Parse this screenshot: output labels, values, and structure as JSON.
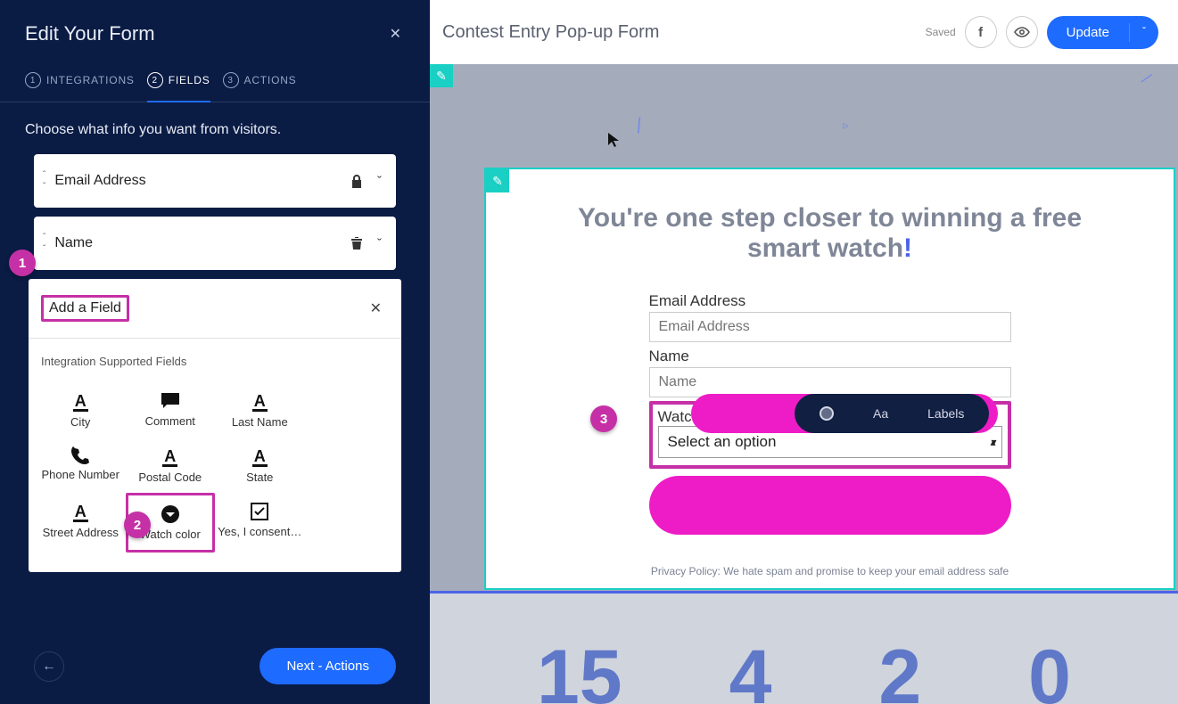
{
  "sidebar": {
    "title": "Edit Your Form",
    "steps": [
      {
        "num": "1",
        "label": "INTEGRATIONS"
      },
      {
        "num": "2",
        "label": "FIELDS"
      },
      {
        "num": "3",
        "label": "ACTIONS"
      }
    ],
    "subtitle": "Choose what info you want from visitors.",
    "fields": [
      {
        "label": "Email Address",
        "locked": true
      },
      {
        "label": "Name",
        "locked": false
      }
    ],
    "addField": {
      "title": "Add a Field",
      "sectionLabel": "Integration Supported Fields",
      "options": [
        {
          "label": "City",
          "icon": "text"
        },
        {
          "label": "Comment",
          "icon": "comment"
        },
        {
          "label": "Last Name",
          "icon": "text"
        },
        {
          "label": "Phone Number",
          "icon": "phone"
        },
        {
          "label": "Postal Code",
          "icon": "text"
        },
        {
          "label": "State",
          "icon": "text"
        },
        {
          "label": "Street Address",
          "icon": "text"
        },
        {
          "label": "Watch color",
          "icon": "dropdown"
        },
        {
          "label": "Yes, I consent…",
          "icon": "checkbox"
        }
      ]
    },
    "next": "Next - Actions"
  },
  "topbar": {
    "title": "Contest Entry Pop-up Form",
    "saved": "Saved",
    "update": "Update"
  },
  "preview": {
    "headline_a": "You're one step closer to winning a",
    "headline_b": "free smart watch",
    "bang": "!",
    "email_label": "Email Address",
    "email_placeholder": "Email Address",
    "name_label": "Name",
    "name_placeholder": "Name",
    "watch_label": "Watch color",
    "watch_select": "Select an option",
    "privacy": "Privacy Policy: We hate spam and promise to keep your email address safe",
    "pill_aa": "Aa",
    "pill_labels": "Labels",
    "countdown": [
      "15",
      "4",
      "2",
      "0"
    ]
  },
  "annotations": {
    "b1": "1",
    "b2": "2",
    "b3": "3"
  }
}
